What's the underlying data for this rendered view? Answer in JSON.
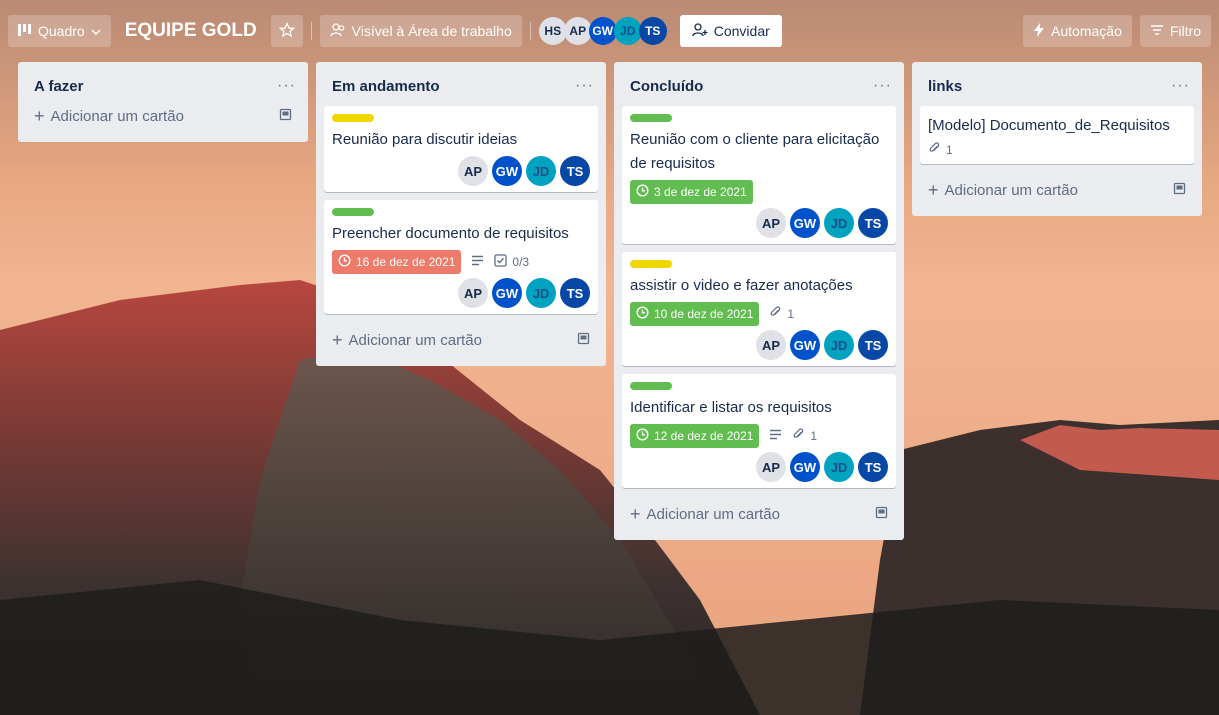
{
  "header": {
    "view_label": "Quadro",
    "board_title": "EQUIPE GOLD",
    "visibility_label": "Visível à Área de trabalho",
    "members": [
      "HS",
      "AP",
      "GW",
      "JD",
      "TS"
    ],
    "invite_label": "Convidar",
    "automation_label": "Automação",
    "filter_label": "Filtro"
  },
  "lists": [
    {
      "title": "A fazer",
      "menu": "···",
      "add_label": "Adicionar um cartão"
    },
    {
      "title": "Em andamento",
      "menu": "···",
      "add_label": "Adicionar um cartão",
      "cards": [
        {
          "title": "Reunião para discutir ideias",
          "members": [
            "AP",
            "GW",
            "JD",
            "TS"
          ]
        },
        {
          "title": "Preencher documento de requisitos",
          "due": "16 de dez de 2021",
          "checklist": "0/3",
          "members": [
            "AP",
            "GW",
            "JD",
            "TS"
          ]
        }
      ]
    },
    {
      "title": "Concluído",
      "menu": "···",
      "add_label": "Adicionar um cartão",
      "cards": [
        {
          "title": "Reunião com o cliente para elicitação de requisitos",
          "due": "3 de dez de 2021",
          "members": [
            "AP",
            "GW",
            "JD",
            "TS"
          ]
        },
        {
          "title": "assistir o video e fazer anotações",
          "due": "10 de dez de 2021",
          "attachments": "1",
          "members": [
            "AP",
            "GW",
            "JD",
            "TS"
          ]
        },
        {
          "title": "Identificar e listar os requisitos",
          "due": "12 de dez de 2021",
          "attachments": "1",
          "members": [
            "AP",
            "GW",
            "JD",
            "TS"
          ]
        }
      ]
    },
    {
      "title": "links",
      "menu": "···",
      "add_label": "Adicionar um cartão",
      "cards": [
        {
          "title": "[Modelo] Documento_de_Requisitos",
          "attachments": "1"
        }
      ]
    }
  ]
}
